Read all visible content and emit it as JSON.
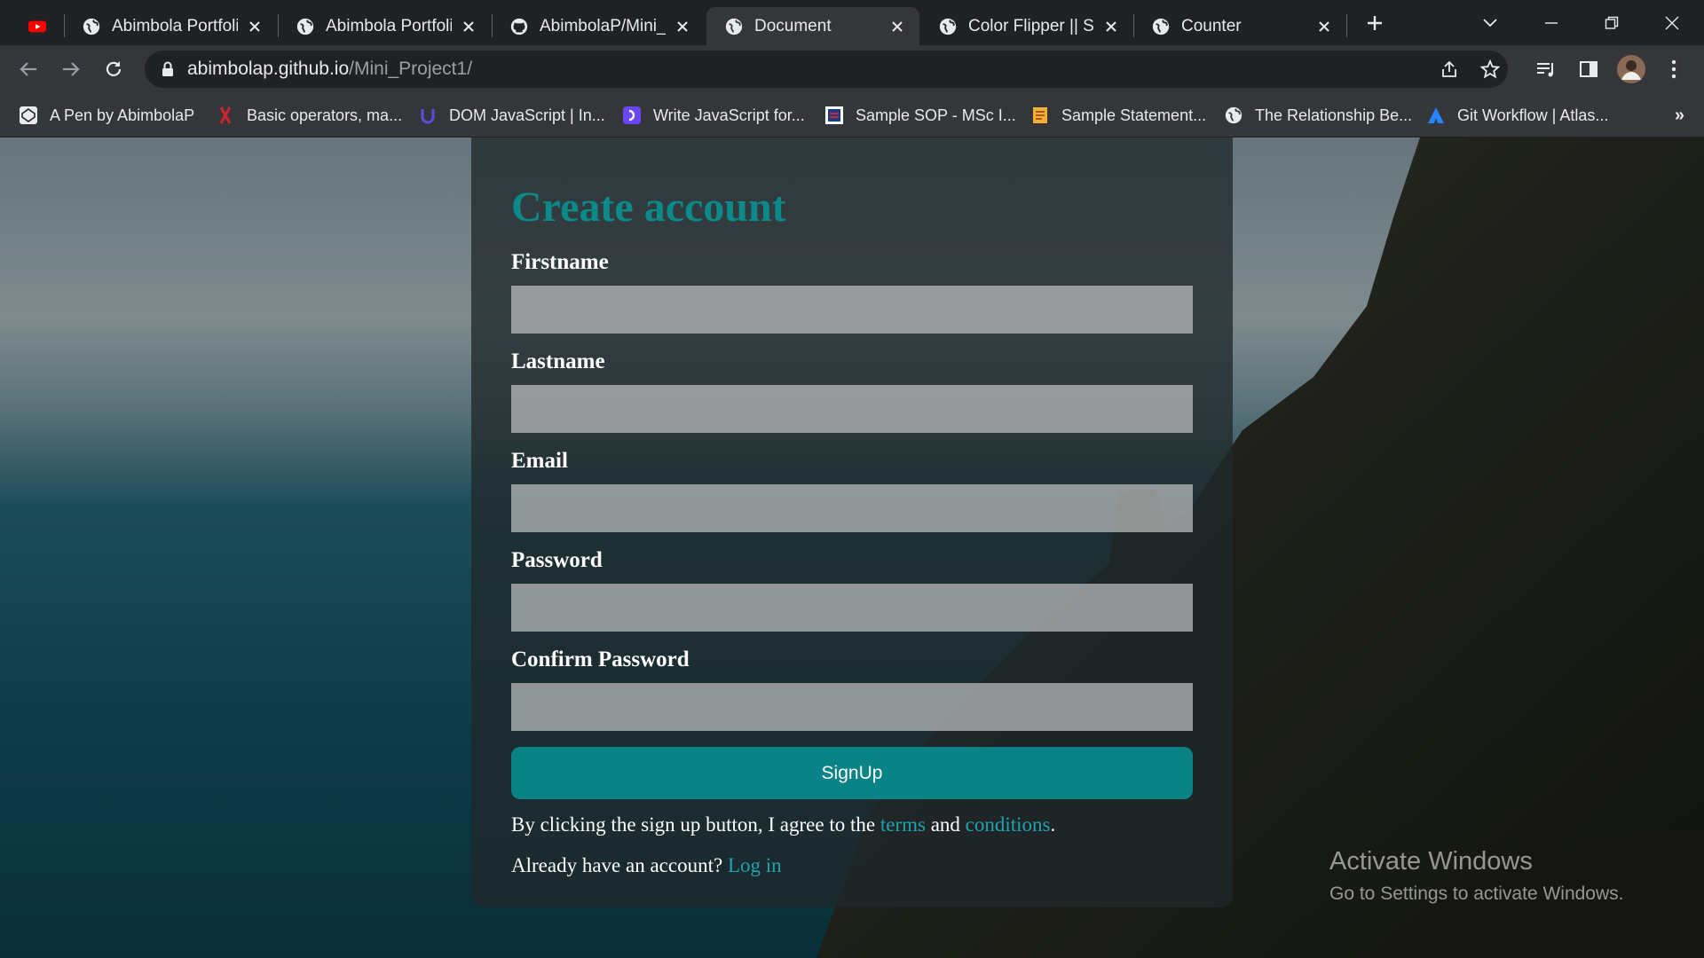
{
  "browser": {
    "tabs": [
      {
        "title": "",
        "icon": "youtube-icon",
        "active": false
      },
      {
        "title": "Abimbola Portfolio",
        "icon": "globe-icon",
        "active": false
      },
      {
        "title": "Abimbola Portfolio",
        "icon": "globe-icon",
        "active": false
      },
      {
        "title": "AbimbolaP/Mini_P",
        "icon": "github-icon",
        "active": false
      },
      {
        "title": "Document",
        "icon": "globe-icon",
        "active": true
      },
      {
        "title": "Color Flipper || Sim",
        "icon": "globe-icon",
        "active": false
      },
      {
        "title": "Counter",
        "icon": "globe-icon",
        "active": false
      }
    ],
    "address": {
      "host": "abimbolap.github.io",
      "path": "/Mini_Project1/"
    },
    "bookmarks": [
      {
        "label": "A Pen by AbimbolaP",
        "icon": "codepen-icon"
      },
      {
        "label": "Basic operators, ma...",
        "icon": "javascript-info-icon"
      },
      {
        "label": "DOM JavaScript | In...",
        "icon": "udemy-icon"
      },
      {
        "label": "Write JavaScript for...",
        "icon": "scrimba-icon"
      },
      {
        "label": "Sample SOP - MSc I...",
        "icon": "university-icon"
      },
      {
        "label": "Sample Statement...",
        "icon": "document-icon"
      },
      {
        "label": "The Relationship Be...",
        "icon": "globe-icon"
      },
      {
        "label": "Git Workflow | Atlas...",
        "icon": "atlassian-icon"
      }
    ],
    "bookmarks_overflow": "»"
  },
  "form": {
    "title": "Create account",
    "fields": [
      {
        "label": "Firstname",
        "value": ""
      },
      {
        "label": "Lastname",
        "value": ""
      },
      {
        "label": "Email",
        "value": ""
      },
      {
        "label": "Password",
        "value": ""
      },
      {
        "label": "Confirm Password",
        "value": ""
      }
    ],
    "submit_label": "SignUp",
    "terms": {
      "prefix": "By clicking the sign up button, I agree to the ",
      "terms_link": "terms",
      "middle": " and ",
      "conditions_link": "conditions",
      "suffix": "."
    },
    "login": {
      "prefix": "Already have an account? ",
      "link": "Log in"
    }
  },
  "watermark": {
    "title": "Activate Windows",
    "subtitle": "Go to Settings to activate Windows."
  },
  "colors": {
    "accent": "#098385",
    "title": "#0b8a89",
    "link": "#1da4b0"
  }
}
